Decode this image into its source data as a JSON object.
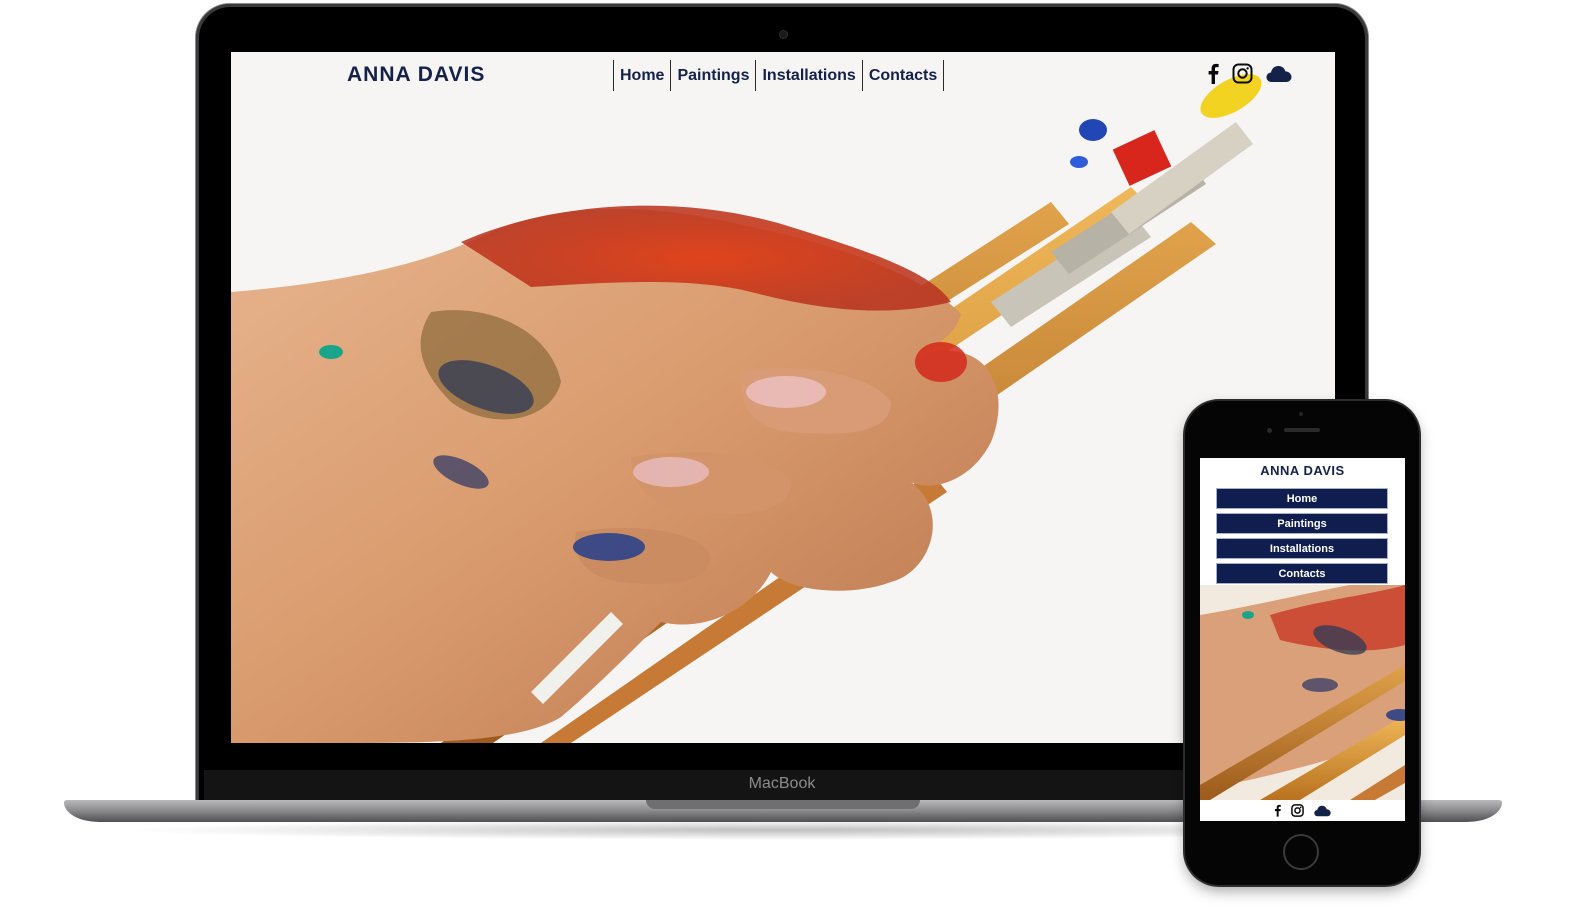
{
  "device_labels": {
    "laptop": "MacBook"
  },
  "site": {
    "logo": "ANNA DAVIS",
    "nav": [
      {
        "label": "Home"
      },
      {
        "label": "Paintings"
      },
      {
        "label": "Installations"
      },
      {
        "label": "Contacts"
      }
    ],
    "social_icons": [
      "facebook-icon",
      "instagram-icon",
      "cloud-icon"
    ],
    "hero_image": "hand-holding-paint-brushes"
  },
  "mobile": {
    "logo": "ANNA DAVIS",
    "menu": [
      {
        "label": "Home"
      },
      {
        "label": "Paintings"
      },
      {
        "label": "Installations"
      },
      {
        "label": "Contacts"
      }
    ]
  },
  "colors": {
    "brand_navy": "#14224a",
    "menu_bg": "#0f1d4f",
    "screen_bg": "#f6f5f3"
  }
}
